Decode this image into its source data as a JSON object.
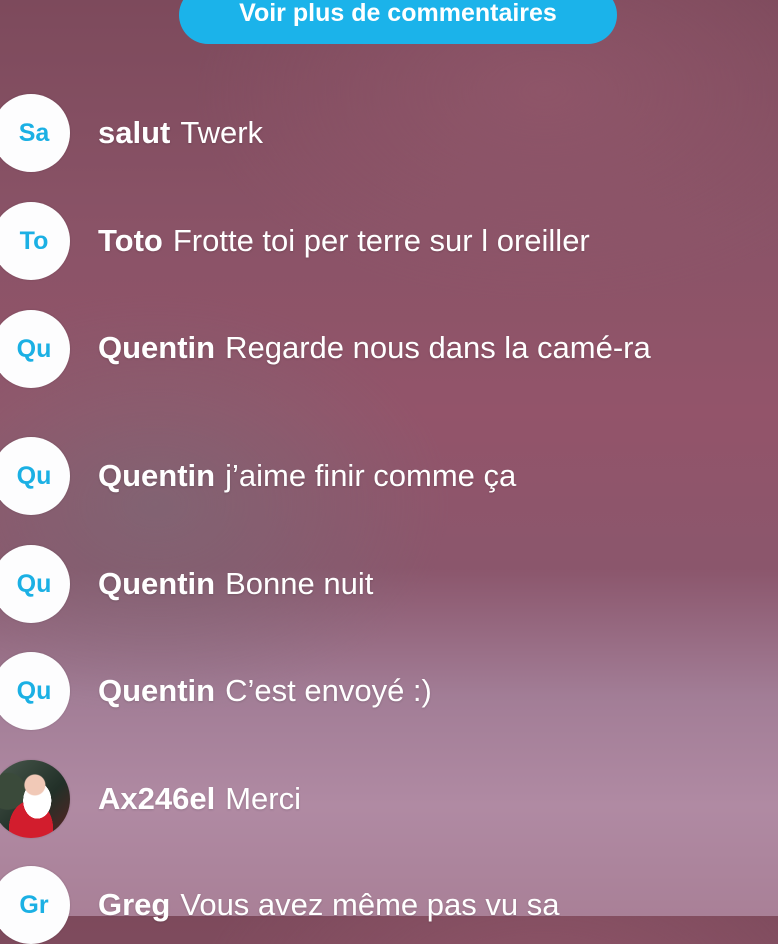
{
  "more_comments_label": "Voir plus de commentaires",
  "comments": [
    {
      "initials": "Sa",
      "name": "salut",
      "text": "Twerk"
    },
    {
      "initials": "To",
      "name": "Toto",
      "text": "Frotte toi per terre sur l oreiller"
    },
    {
      "initials": "Qu",
      "name": "Quentin",
      "text": "Regarde nous dans la camé-ra"
    },
    {
      "initials": "Qu",
      "name": "Quentin",
      "text": "j’aime finir comme ça"
    },
    {
      "initials": "Qu",
      "name": "Quentin",
      "text": "Bonne nuit"
    },
    {
      "initials": "Qu",
      "name": "Quentin",
      "text": "C’est envoyé :)"
    },
    {
      "initials": "",
      "name": "Ax246el",
      "text": "Merci"
    },
    {
      "initials": "Gr",
      "name": "Greg",
      "text": "Vous avez même pas vu sa"
    }
  ],
  "colors": {
    "accent": "#1bb3ea",
    "avatar_bg": "#fdfdfe"
  }
}
